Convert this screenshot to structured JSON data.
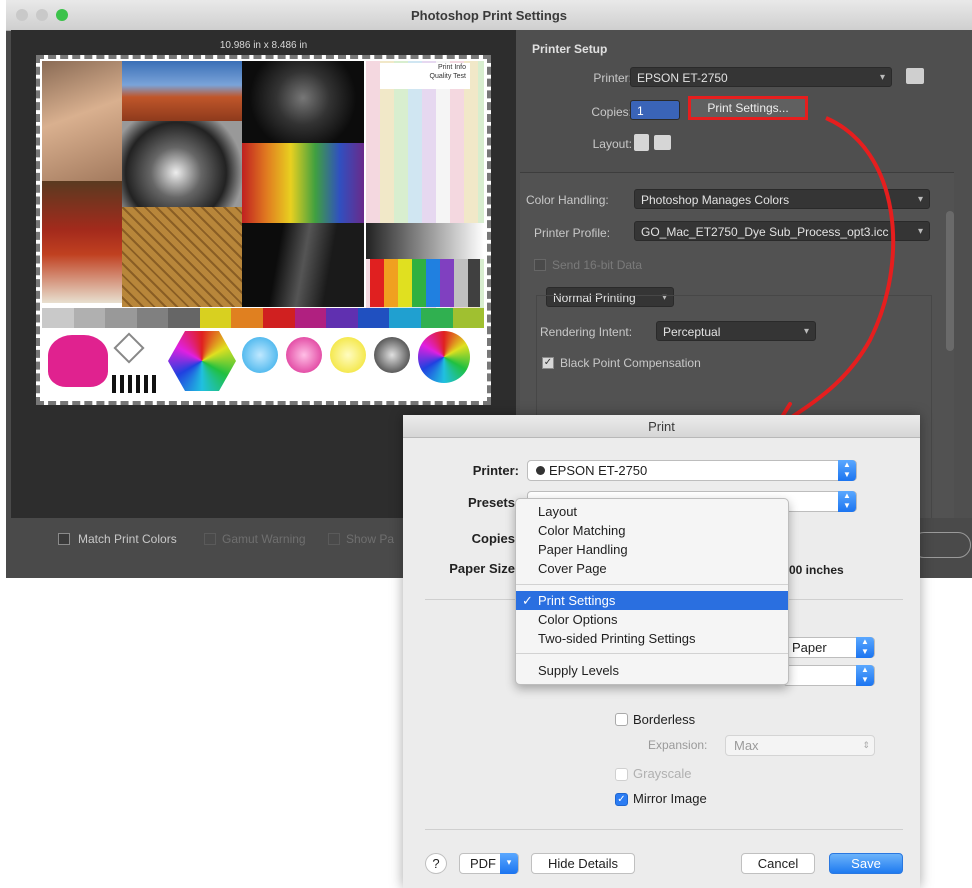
{
  "photoshop": {
    "title": "Photoshop Print Settings",
    "print_size": "10.986 in x 8.486 in",
    "printer_setup": {
      "heading": "Printer Setup",
      "printer_label": "Printer:",
      "printer_value": "EPSON ET-2750",
      "copies_label": "Copies:",
      "copies_value": "1",
      "print_settings_button": "Print Settings...",
      "layout_label": "Layout:"
    },
    "color": {
      "handling_label": "Color Handling:",
      "handling_value": "Photoshop Manages Colors",
      "profile_label": "Printer Profile:",
      "profile_value": "GO_Mac_ET2750_Dye Sub_Process_opt3.icc",
      "send16_label": "Send 16-bit Data",
      "normal_printing": "Normal Printing",
      "rendering_label": "Rendering Intent:",
      "rendering_value": "Perceptual",
      "bpc_label": "Black Point Compensation"
    },
    "bottom": {
      "match_colors": "Match Print Colors",
      "gamut_warning": "Gamut Warning",
      "show_paper": "Show Pa"
    },
    "test_image": {
      "logo_text": "Print Info\nQuality Test"
    }
  },
  "print_dialog": {
    "title": "Print",
    "printer_label": "Printer:",
    "printer_value": "EPSON ET-2750",
    "presets_label": "Presets",
    "copies_label": "Copies",
    "paper_size_label": "Paper Size",
    "paper_size_tail": "00 inches",
    "media_tail": "Paper",
    "borderless": "Borderless",
    "expansion_label": "Expansion:",
    "expansion_value": "Max",
    "grayscale": "Grayscale",
    "mirror_image": "Mirror Image",
    "help": "?",
    "pdf": "PDF",
    "hide_details": "Hide Details",
    "cancel": "Cancel",
    "save": "Save"
  },
  "preset_menu": {
    "items_top": [
      "Layout",
      "Color Matching",
      "Paper Handling",
      "Cover Page"
    ],
    "selected": "Print Settings",
    "items_mid": [
      "Color Options",
      "Two-sided Printing Settings"
    ],
    "items_bottom": [
      "Supply Levels"
    ]
  },
  "colors": {
    "highlight_red": "#e61e1e",
    "mac_blue": "#2a6fe0"
  }
}
